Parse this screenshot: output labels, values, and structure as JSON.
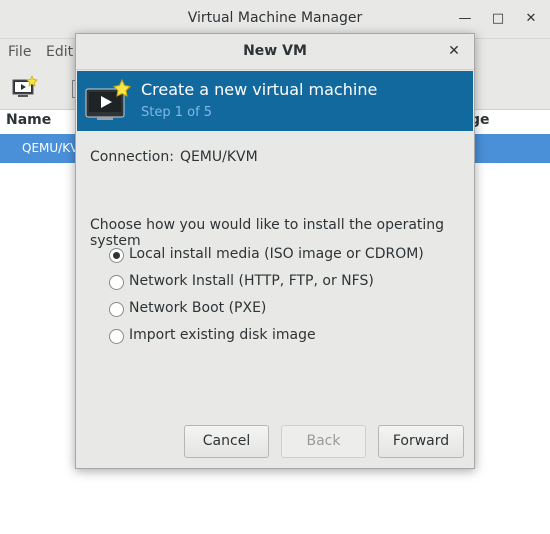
{
  "main_window": {
    "title": "Virtual Machine Manager",
    "menu": [
      "File",
      "Edit"
    ],
    "column_headers": [
      "Name",
      "ge"
    ],
    "list_row": "QEMU/KV"
  },
  "dialog": {
    "title": "New VM",
    "banner": {
      "title": "Create a new virtual machine",
      "step": "Step 1 of 5"
    },
    "connection": {
      "label": "Connection:",
      "value": "QEMU/KVM"
    },
    "install_prompt": "Choose how you would like to install the operating system",
    "install_options": [
      {
        "label": "Local install media (ISO image or CDROM)",
        "selected": true
      },
      {
        "label": "Network Install (HTTP, FTP, or NFS)",
        "selected": false
      },
      {
        "label": "Network Boot (PXE)",
        "selected": false
      },
      {
        "label": "Import existing disk image",
        "selected": false
      }
    ],
    "buttons": {
      "cancel": "Cancel",
      "back": "Back",
      "forward": "Forward"
    }
  },
  "colors": {
    "banner": "#12699e",
    "selection": "#4a90d9"
  }
}
